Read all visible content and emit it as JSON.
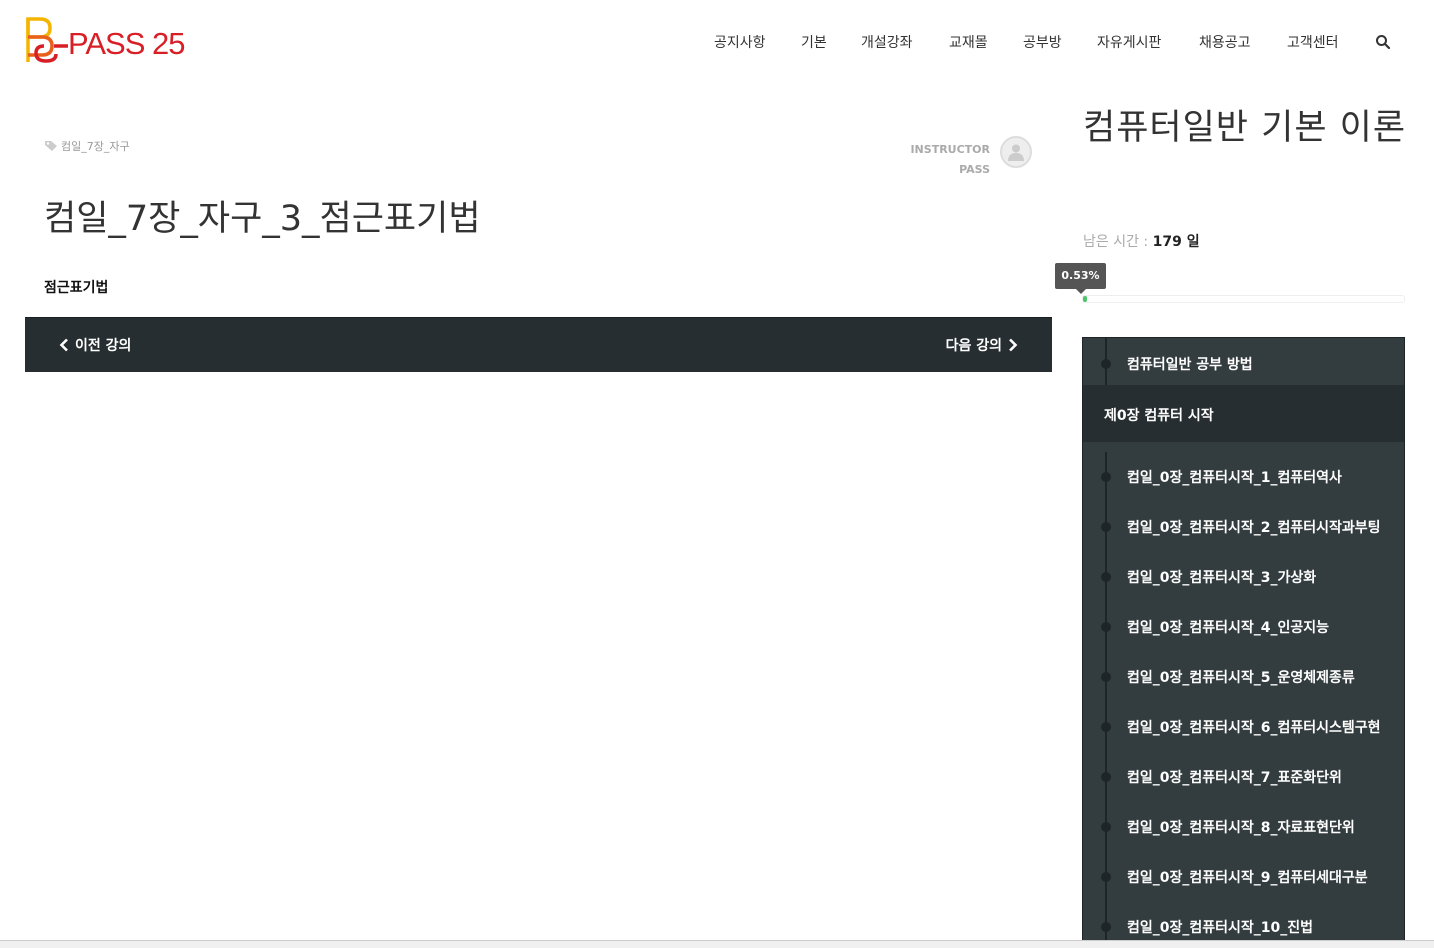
{
  "header": {
    "logo_text": "PASS 25",
    "nav": [
      "공지사항",
      "기본",
      "개설강좌",
      "교재몰",
      "공부방",
      "자유게시판",
      "채용공고",
      "고객센터"
    ]
  },
  "lesson": {
    "tag": "컴일_7장_자구",
    "instructor_label": "INSTRUCTOR",
    "instructor_name": "PASS",
    "title": "컴일_7장_자구_3_점근표기법",
    "description": "점근표기법",
    "prev_label": "이전 강의",
    "next_label": "다음 강의"
  },
  "sidebar": {
    "course_title": "컴퓨터일반 기본 이론",
    "remain_label": "남은 시간 :",
    "remain_value": "179 일",
    "progress_text": "0.53%",
    "progress": 0.0053,
    "first_item": "컴퓨터일반 공부 방법",
    "section": "제0장 컴퓨터 시작",
    "items": [
      "컴일_0장_컴퓨터시작_1_컴퓨터역사",
      "컴일_0장_컴퓨터시작_2_컴퓨터시작과부팅",
      "컴일_0장_컴퓨터시작_3_가상화",
      "컴일_0장_컴퓨터시작_4_인공지능",
      "컴일_0장_컴퓨터시작_5_운영체제종류",
      "컴일_0장_컴퓨터시작_6_컴퓨터시스템구현",
      "컴일_0장_컴퓨터시작_7_표준화단위",
      "컴일_0장_컴퓨터시작_8_자료표현단위",
      "컴일_0장_컴퓨터시작_9_컴퓨터세대구분",
      "컴일_0장_컴퓨터시작_10_진법"
    ]
  },
  "colors": {
    "brand_red": "#d81f26",
    "brand_yellow": "#f5b400",
    "dark_panel": "#333c3f",
    "progress_green": "#4cc46a"
  }
}
